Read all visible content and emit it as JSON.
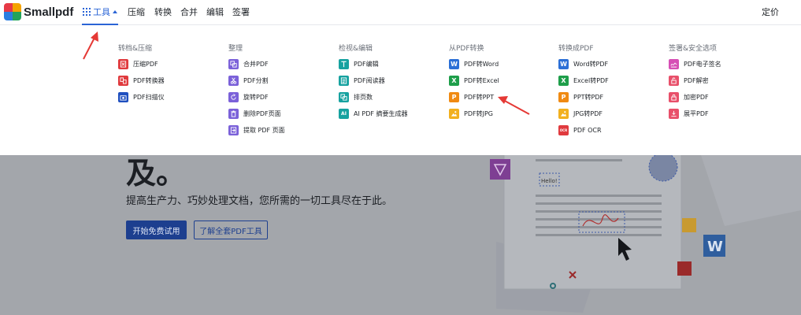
{
  "brand": {
    "name": "Smallpdf"
  },
  "nav": {
    "tools_label": "工具",
    "links": [
      "压缩",
      "转换",
      "合并",
      "编辑",
      "签署"
    ],
    "pricing": "定价"
  },
  "menu": {
    "columns": [
      {
        "heading": "转档&压缩",
        "items": [
          {
            "label": "压缩PDF",
            "icon": "compress-icon",
            "color": "#e03a3e"
          },
          {
            "label": "PDF转换器",
            "icon": "converter-icon",
            "color": "#e03a3e"
          },
          {
            "label": "PDF扫描仪",
            "icon": "camera-icon",
            "color": "#1f4fbf"
          }
        ]
      },
      {
        "heading": "整理",
        "items": [
          {
            "label": "合并PDF",
            "icon": "merge-icon",
            "color": "#7b61d9"
          },
          {
            "label": "PDF分割",
            "icon": "scissors-icon",
            "color": "#7b61d9"
          },
          {
            "label": "旋转PDF",
            "icon": "rotate-icon",
            "color": "#7b61d9"
          },
          {
            "label": "删除PDF页面",
            "icon": "delete-pages-icon",
            "color": "#7b61d9"
          },
          {
            "label": "提取 PDF 页面",
            "icon": "extract-pages-icon",
            "color": "#7b61d9"
          }
        ]
      },
      {
        "heading": "检视&编辑",
        "items": [
          {
            "label": "PDF编辑",
            "icon": "text-edit-icon",
            "color": "#17a2a0"
          },
          {
            "label": "PDF阅读器",
            "icon": "reader-icon",
            "color": "#17a2a0"
          },
          {
            "label": "排页数",
            "icon": "page-number-icon",
            "color": "#17a2a0"
          },
          {
            "label": "AI PDF 摘要生成器",
            "icon": "ai-icon",
            "color": "#17a2a0",
            "glyph": "AI"
          }
        ]
      },
      {
        "heading": "从PDF转换",
        "items": [
          {
            "label": "PDF转Word",
            "icon": "word-icon",
            "color": "#2b6fd6",
            "glyph": "W"
          },
          {
            "label": "PDF转Excel",
            "icon": "excel-icon",
            "color": "#1e9e4a",
            "glyph": "X"
          },
          {
            "label": "PDF转PPT",
            "icon": "ppt-icon",
            "color": "#f08a12",
            "glyph": "P"
          },
          {
            "label": "PDF转JPG",
            "icon": "image-icon",
            "color": "#f2b01e"
          }
        ]
      },
      {
        "heading": "转换成PDF",
        "items": [
          {
            "label": "Word转PDF",
            "icon": "word-icon",
            "color": "#2b6fd6",
            "glyph": "W"
          },
          {
            "label": "Excel转PDF",
            "icon": "excel-icon",
            "color": "#1e9e4a",
            "glyph": "X"
          },
          {
            "label": "PPT转PDF",
            "icon": "ppt-icon",
            "color": "#f08a12",
            "glyph": "P"
          },
          {
            "label": "JPG转PDF",
            "icon": "image-icon",
            "color": "#f2b01e"
          },
          {
            "label": "PDF OCR",
            "icon": "ocr-icon",
            "color": "#e03a3e",
            "glyph": "OCR"
          }
        ]
      },
      {
        "heading": "签署&安全选项",
        "items": [
          {
            "label": "PDF电子签名",
            "icon": "signature-icon",
            "color": "#d64fb5"
          },
          {
            "label": "PDF解密",
            "icon": "unlock-icon",
            "color": "#e8506a"
          },
          {
            "label": "加密PDF",
            "icon": "lock-icon",
            "color": "#e8506a"
          },
          {
            "label": "展平PDF",
            "icon": "flatten-icon",
            "color": "#e8506a"
          }
        ]
      }
    ]
  },
  "hero": {
    "title_fragment": "及。",
    "subtitle": "提高生产力、巧妙处理文档，您所需的一切工具尽在于此。",
    "primary_button": "开始免费试用",
    "secondary_button": "了解全套PDF工具",
    "illustration_hello": "Hello!",
    "word_badge": "W"
  },
  "colors": {
    "accent": "#2a64d6",
    "overlay": "#a3a6ab",
    "annotation_arrow": "#e53935"
  }
}
